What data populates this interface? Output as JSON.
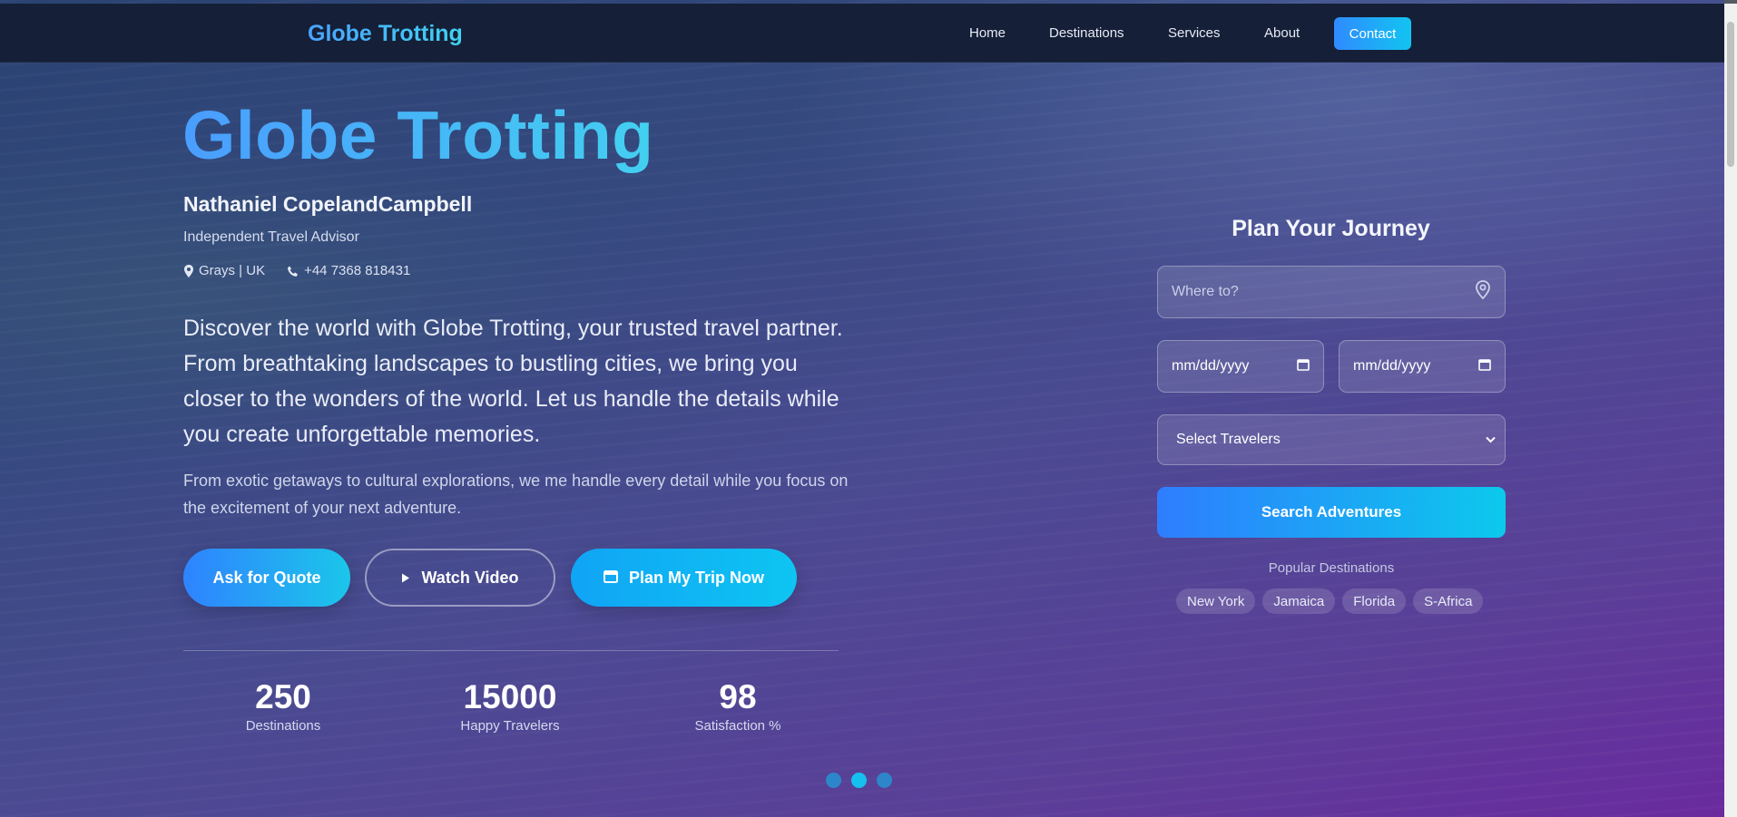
{
  "navbar": {
    "brand": "Globe Trotting",
    "links": [
      "Home",
      "Destinations",
      "Services",
      "About"
    ],
    "contact_label": "Contact"
  },
  "hero": {
    "title": "Globe Trotting",
    "advisor_name": "Nathaniel CopelandCampbell",
    "advisor_role": "Independent Travel Advisor",
    "location": "Grays | UK",
    "phone": "+44 7368 818431",
    "lead": "Discover the world with Globe Trotting, your trusted travel partner. From breathtaking landscapes to bustling cities, we bring you closer to the wonders of the world. Let us handle the details while you create unforgettable memories.",
    "sub": "From exotic getaways to cultural explorations, we me handle every detail while you focus on the excitement of your next adventure.",
    "buttons": {
      "quote": "Ask for Quote",
      "video": "Watch Video",
      "plan": "Plan My Trip Now"
    },
    "stats": [
      {
        "value": "250",
        "label": "Destinations"
      },
      {
        "value": "15000",
        "label": "Happy Travelers"
      },
      {
        "value": "98",
        "label": "Satisfaction %"
      }
    ],
    "carousel": {
      "slides": 3,
      "active_index": 1
    }
  },
  "planner": {
    "title": "Plan Your Journey",
    "where_placeholder": "Where to?",
    "date_from_placeholder": "mm/dd/yyyy",
    "date_to_placeholder": "mm/dd/yyyy",
    "travelers_selected": "Select Travelers",
    "search_label": "Search Adventures",
    "popular_label": "Popular Destinations",
    "popular": [
      "New York",
      "Jamaica",
      "Florida",
      "S-Africa"
    ]
  },
  "colors": {
    "accent_blue": "#2f83ff",
    "accent_cyan": "#12c4f0",
    "navbar_bg": "#151f37"
  },
  "icons": {
    "location": "map-pin-icon",
    "phone": "phone-icon",
    "play": "play-icon",
    "plan": "calendar-icon",
    "where": "map-pin-outline-icon",
    "date": "calendar-icon",
    "select": "chevron-down-icon"
  }
}
